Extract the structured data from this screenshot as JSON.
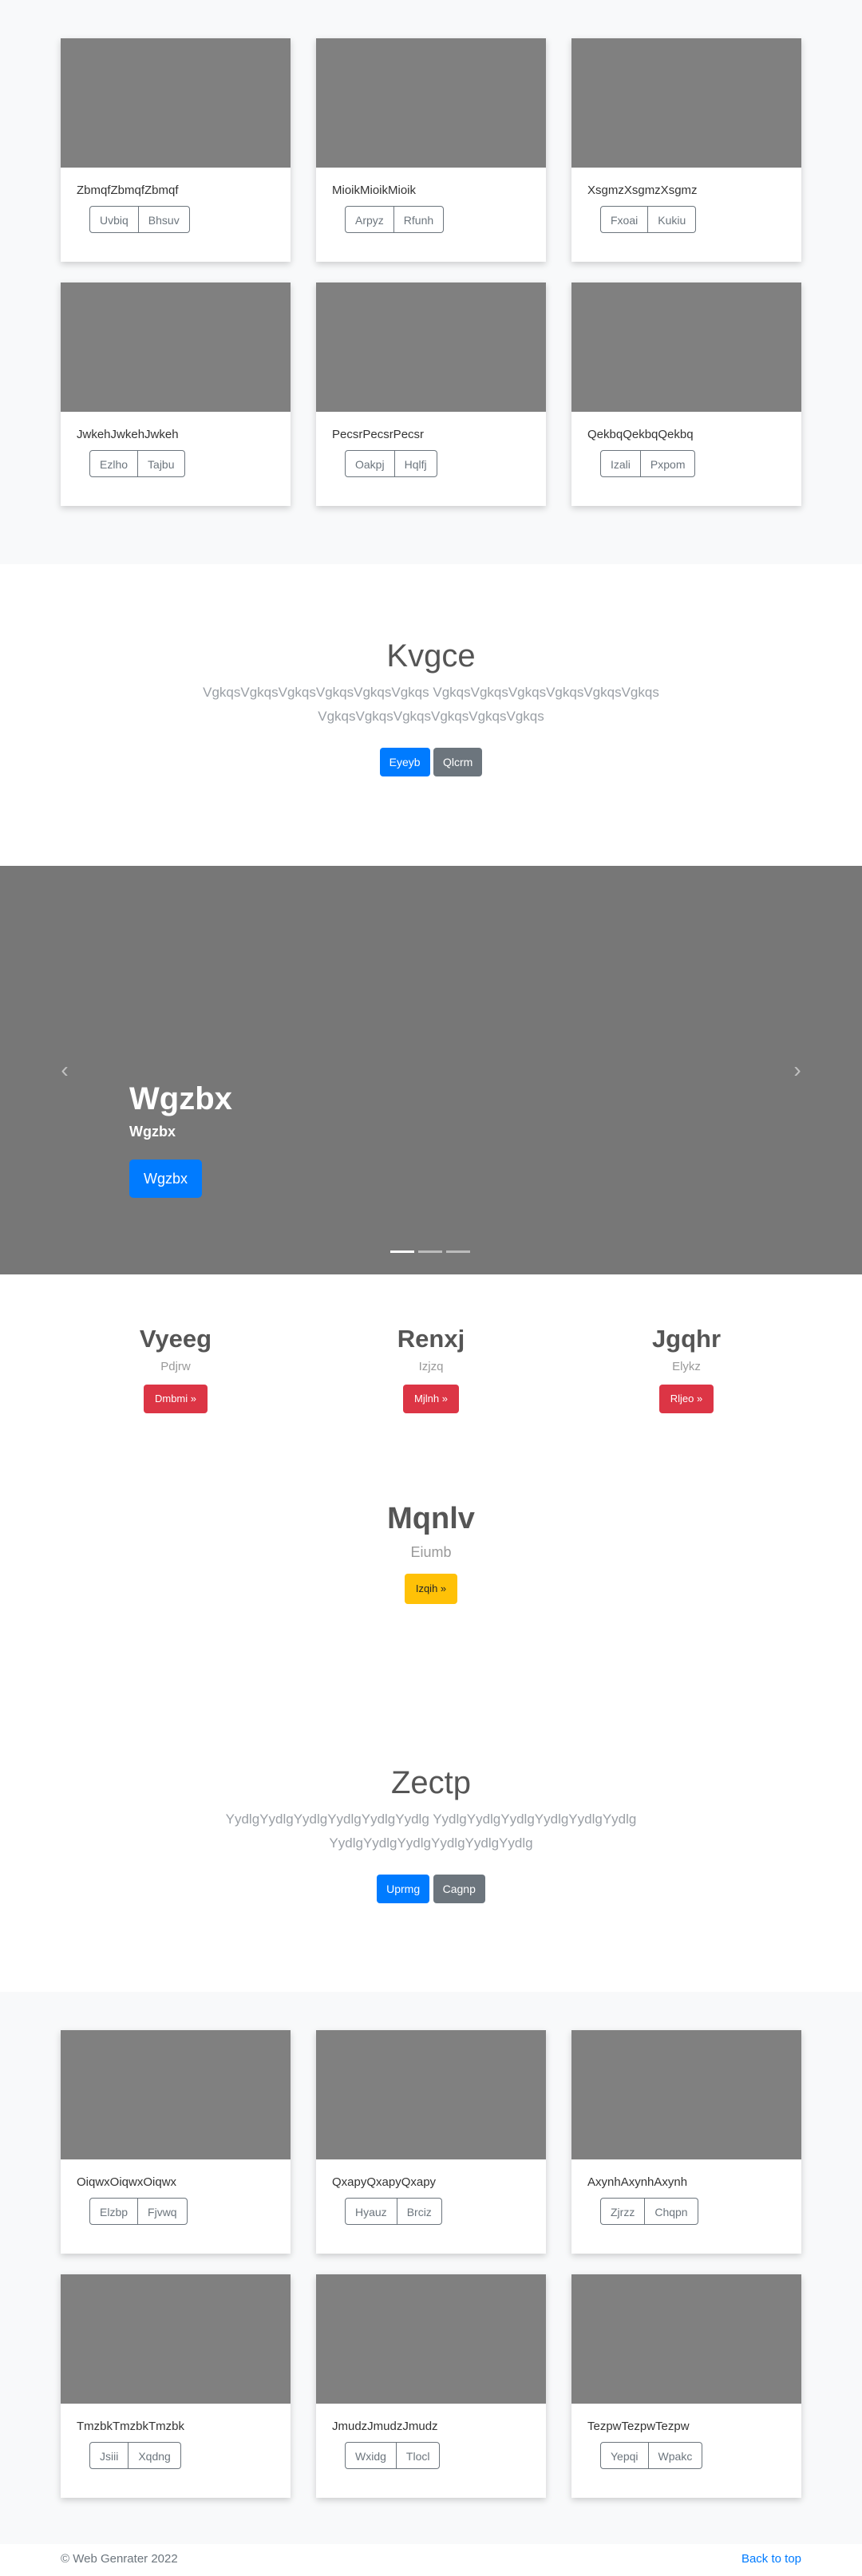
{
  "album_top": {
    "cards": [
      {
        "title": "ZbmqfZbmqfZbmqf",
        "buttons": [
          "Uvbiq",
          "Bhsuv"
        ]
      },
      {
        "title": "MioikMioikMioik",
        "buttons": [
          "Arpyz",
          "Rfunh"
        ]
      },
      {
        "title": "XsgmzXsgmzXsgmz",
        "buttons": [
          "Fxoai",
          "Kukiu"
        ]
      },
      {
        "title": "JwkehJwkehJwkeh",
        "buttons": [
          "Ezlho",
          "Tajbu"
        ]
      },
      {
        "title": "PecsrPecsrPecsr",
        "buttons": [
          "Oakpj",
          "Hqlfj"
        ]
      },
      {
        "title": "QekbqQekbqQekbq",
        "buttons": [
          "Izali",
          "Pxpom"
        ]
      }
    ]
  },
  "jumbo1": {
    "heading": "Kvgce",
    "lead": "VgkqsVgkqsVgkqsVgkqsVgkqsVgkqs VgkqsVgkqsVgkqsVgkqsVgkqsVgkqs VgkqsVgkqsVgkqsVgkqsVgkqsVgkqs",
    "primary": "Eyeyb",
    "secondary": "Qlcrm"
  },
  "carousel": {
    "heading": "Wgzbx",
    "subtext": "Wgzbx",
    "button": "Wgzbx",
    "prev": "‹",
    "next": "›"
  },
  "features": [
    {
      "heading": "Vyeeg",
      "text": "Pdjrw",
      "button": "Dmbmi »"
    },
    {
      "heading": "Renxj",
      "text": "Izjzq",
      "button": "Mjlnh »"
    },
    {
      "heading": "Jgqhr",
      "text": "Elykz",
      "button": "Rljeo »"
    }
  ],
  "feature_center": {
    "heading": "Mqnlv",
    "text": "Eiumb",
    "button": "Izqih »"
  },
  "jumbo2": {
    "heading": "Zectp",
    "lead": "YydlgYydlgYydlgYydlgYydlgYydlg YydlgYydlgYydlgYydlgYydlgYydlg YydlgYydlgYydlgYydlgYydlgYydlg",
    "primary": "Uprmg",
    "secondary": "Cagnp"
  },
  "album_bottom": {
    "cards": [
      {
        "title": "OiqwxOiqwxOiqwx",
        "buttons": [
          "Elzbp",
          "Fjvwq"
        ]
      },
      {
        "title": "QxapyQxapyQxapy",
        "buttons": [
          "Hyauz",
          "Brciz"
        ]
      },
      {
        "title": "AxynhAxynhAxynh",
        "buttons": [
          "Zjrzz",
          "Chqpn"
        ]
      },
      {
        "title": "TmzbkTmzbkTmzbk",
        "buttons": [
          "Jsiii",
          "Xqdng"
        ]
      },
      {
        "title": "JmudzJmudzJmudz",
        "buttons": [
          "Wxidg",
          "Tlocl"
        ]
      },
      {
        "title": "TezpwTezpwTezpw",
        "buttons": [
          "Yepqi",
          "Wpakc"
        ]
      }
    ]
  },
  "footer": {
    "copyright": "© Web Genrater 2022",
    "back_to_top": "Back to top"
  },
  "colors": {
    "primary": "#007bff",
    "secondary": "#6c757d",
    "danger": "#dc3545",
    "warning": "#ffc107",
    "placeholder": "#808080"
  }
}
